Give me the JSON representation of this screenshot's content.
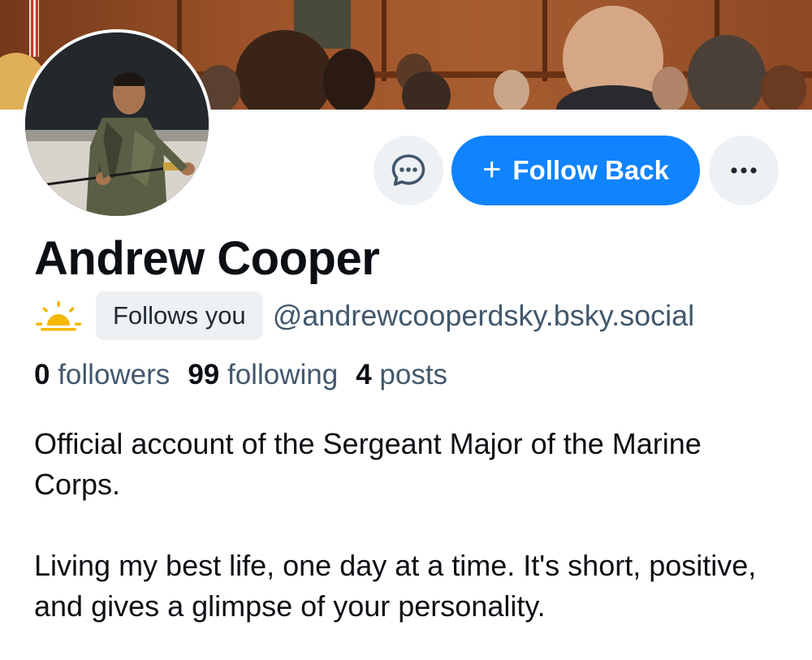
{
  "profile": {
    "display_name": "Andrew Cooper",
    "handle": "@andrewcooperdsky.bsky.social",
    "follows_you_label": "Follows you",
    "status_icon": "sun-icon"
  },
  "actions": {
    "message_icon": "message-icon",
    "follow_back_label": "Follow Back",
    "follow_back_icon": "+",
    "more_icon": "ellipsis-icon"
  },
  "stats": {
    "followers_count": "0",
    "followers_label": "followers",
    "following_count": "99",
    "following_label": "following",
    "posts_count": "4",
    "posts_label": "posts"
  },
  "bio": {
    "paragraph1": "Official account of the Sergeant Major of the Marine Corps.",
    "paragraph2": "Living my best life, one day at a time. It's short, positive, and gives a glimpse of your personality."
  },
  "colors": {
    "accent": "#1083fe",
    "secondary_text": "#42576c",
    "button_bg": "#eef1f4",
    "status_icon": "#f5b800"
  }
}
